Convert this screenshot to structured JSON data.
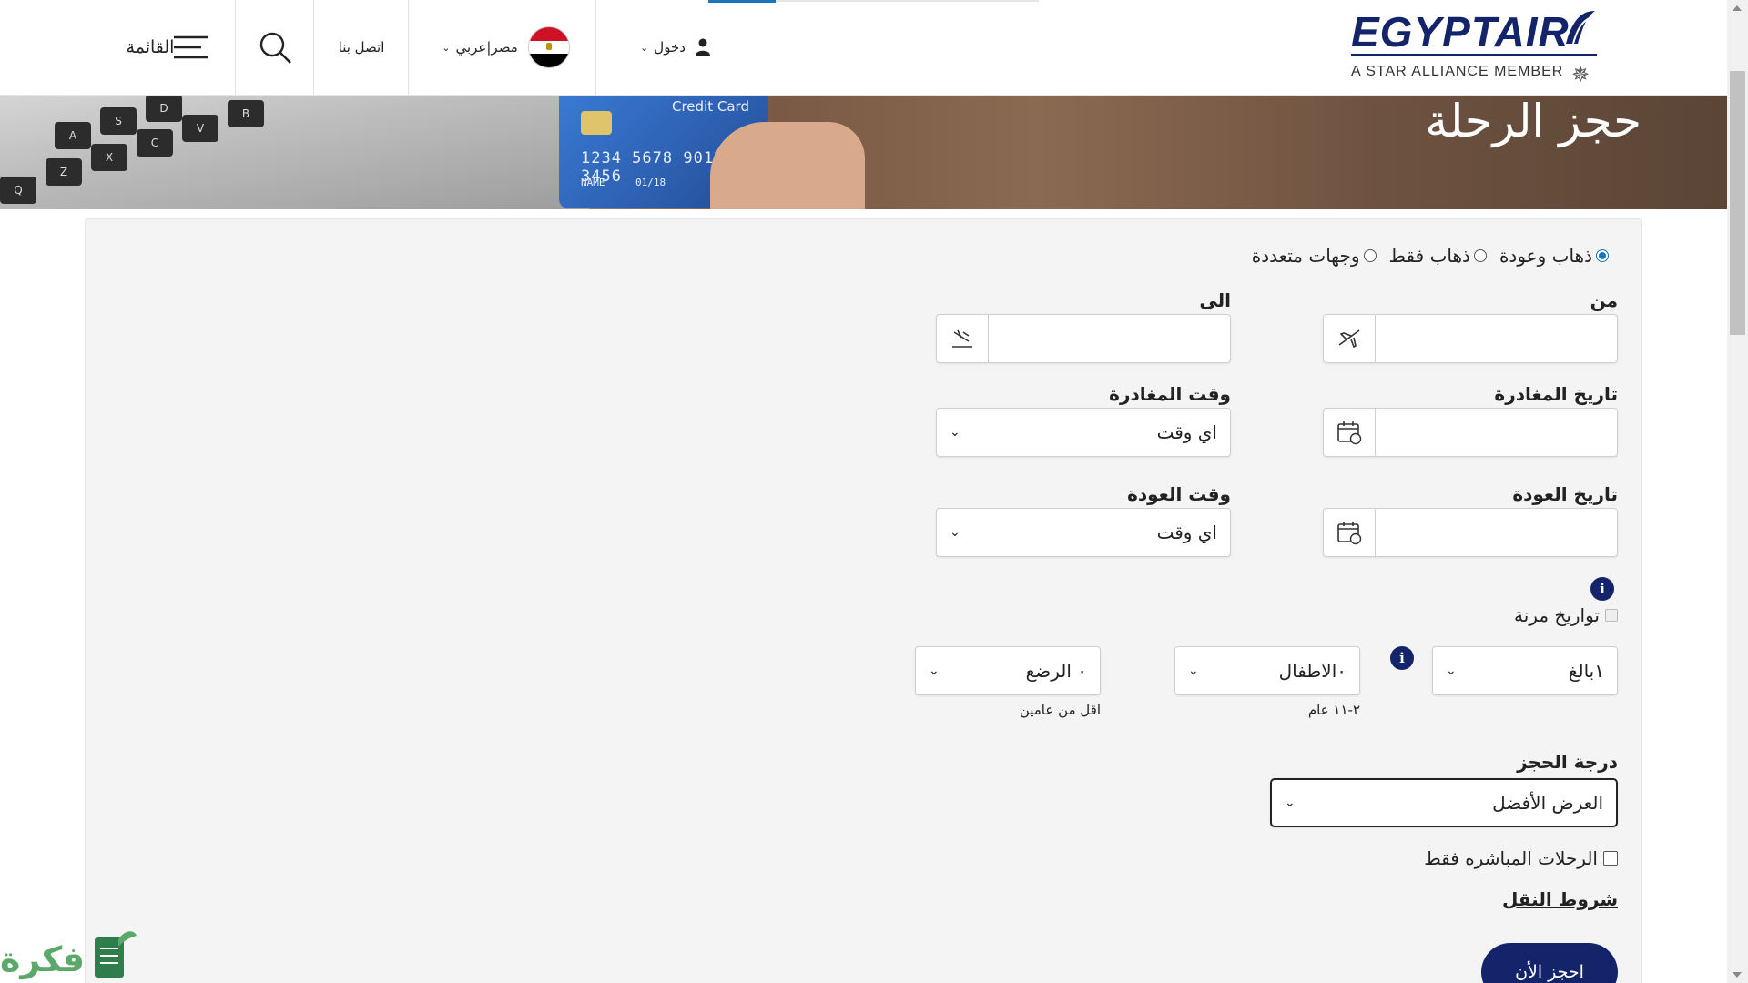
{
  "header": {
    "brand": "EGYPTAIR",
    "alliance": "A STAR ALLIANCE MEMBER",
    "login_label": "دخول",
    "language_label": "مصر|عربي",
    "contact_label": "اتصل بنا",
    "menu_label": "القائمة"
  },
  "hero": {
    "title": "حجز الرحلة",
    "card_label": "Credit Card",
    "card_number": "1234 5678 9012 3456",
    "card_name": "NAME",
    "card_expiry": "01/18"
  },
  "form": {
    "trip_types": [
      {
        "label": "ذهاب وعودة",
        "checked": true
      },
      {
        "label": "ذهاب فقط",
        "checked": false
      },
      {
        "label": "وجهات متعددة",
        "checked": false
      }
    ],
    "from_label": "من",
    "to_label": "الى",
    "from_value": "",
    "to_value": "",
    "departure_date_label": "تاريخ المغادرة",
    "departure_time_label": "وقت المغادرة",
    "departure_time_value": "اي وقت",
    "return_date_label": "تاريخ العودة",
    "return_time_label": "وقت العودة",
    "return_time_value": "اي وقت",
    "flexible_dates_label": "تواريخ مرنة",
    "adults_value": "١بالغ",
    "children_value": "٠الاطفال",
    "children_hint": "٢-١١ عام",
    "infants_value": "٠ الرضع",
    "infants_hint": "اقل من عامين",
    "cabin_label": "درجة الحجز",
    "cabin_value": "العرض الأفضل",
    "direct_only_label": "الرحلات المباشره فقط",
    "terms_link": "شروط النقل",
    "book_button": "احجز الأن"
  },
  "watermark": {
    "text": "فكرة"
  },
  "colors": {
    "brand_navy": "#13246b",
    "accent_blue": "#1c75bc",
    "panel_bg": "#f4f4f4"
  }
}
